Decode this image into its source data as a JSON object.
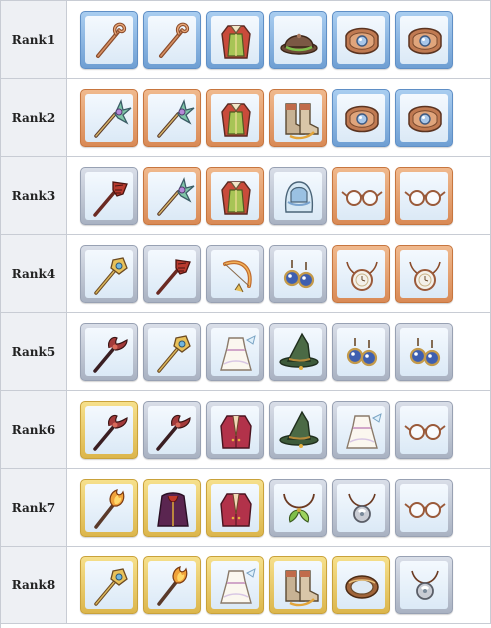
{
  "ranks": [
    {
      "label": "Rank1",
      "items": [
        {
          "icon": "staff-icon",
          "frame": "blue"
        },
        {
          "icon": "staff-icon",
          "frame": "blue"
        },
        {
          "icon": "robe-icon",
          "frame": "blue"
        },
        {
          "icon": "hat-icon",
          "frame": "blue"
        },
        {
          "icon": "bracelet-icon",
          "frame": "blue"
        },
        {
          "icon": "bracelet-icon",
          "frame": "blue"
        }
      ]
    },
    {
      "label": "Rank2",
      "items": [
        {
          "icon": "wand-icon",
          "frame": "copper"
        },
        {
          "icon": "wand-icon",
          "frame": "copper"
        },
        {
          "icon": "robe-icon",
          "frame": "copper"
        },
        {
          "icon": "boots-icon",
          "frame": "copper"
        },
        {
          "icon": "bracelet-icon",
          "frame": "blue"
        },
        {
          "icon": "bracelet-icon",
          "frame": "blue"
        }
      ]
    },
    {
      "label": "Rank3",
      "items": [
        {
          "icon": "spear-icon",
          "frame": "silver"
        },
        {
          "icon": "wand-icon",
          "frame": "copper"
        },
        {
          "icon": "robe-icon",
          "frame": "copper"
        },
        {
          "icon": "hood-icon",
          "frame": "silver"
        },
        {
          "icon": "glasses-icon",
          "frame": "copper"
        },
        {
          "icon": "glasses-icon",
          "frame": "copper"
        }
      ]
    },
    {
      "label": "Rank4",
      "items": [
        {
          "icon": "scepter-icon",
          "frame": "silver"
        },
        {
          "icon": "spear-icon",
          "frame": "silver"
        },
        {
          "icon": "bow-icon",
          "frame": "silver"
        },
        {
          "icon": "earring-icon",
          "frame": "silver"
        },
        {
          "icon": "pendant-icon",
          "frame": "copper"
        },
        {
          "icon": "pendant-icon",
          "frame": "copper"
        }
      ]
    },
    {
      "label": "Rank5",
      "items": [
        {
          "icon": "trident-icon",
          "frame": "silver"
        },
        {
          "icon": "scepter-icon",
          "frame": "silver"
        },
        {
          "icon": "dress-icon",
          "frame": "silver"
        },
        {
          "icon": "witch-hat-icon",
          "frame": "silver"
        },
        {
          "icon": "earring-icon",
          "frame": "silver"
        },
        {
          "icon": "earring-icon",
          "frame": "silver"
        }
      ]
    },
    {
      "label": "Rank6",
      "items": [
        {
          "icon": "trident-icon",
          "frame": "gold"
        },
        {
          "icon": "trident-icon",
          "frame": "silver"
        },
        {
          "icon": "coat-icon",
          "frame": "silver"
        },
        {
          "icon": "witch-hat-icon",
          "frame": "silver"
        },
        {
          "icon": "dress-icon",
          "frame": "silver"
        },
        {
          "icon": "glasses-icon",
          "frame": "silver"
        }
      ]
    },
    {
      "label": "Rank7",
      "items": [
        {
          "icon": "flame-staff-icon",
          "frame": "gold"
        },
        {
          "icon": "cloak-icon",
          "frame": "gold"
        },
        {
          "icon": "coat-icon",
          "frame": "gold"
        },
        {
          "icon": "leaf-necklace-icon",
          "frame": "silver"
        },
        {
          "icon": "amulet-icon",
          "frame": "silver"
        },
        {
          "icon": "glasses-icon",
          "frame": "silver"
        }
      ]
    },
    {
      "label": "Rank8",
      "items": [
        {
          "icon": "scepter-icon",
          "frame": "gold"
        },
        {
          "icon": "flame-staff-icon",
          "frame": "gold"
        },
        {
          "icon": "dress-icon",
          "frame": "gold"
        },
        {
          "icon": "boots-icon",
          "frame": "gold"
        },
        {
          "icon": "ring-icon",
          "frame": "gold"
        },
        {
          "icon": "amulet-icon",
          "frame": "silver"
        }
      ]
    }
  ]
}
